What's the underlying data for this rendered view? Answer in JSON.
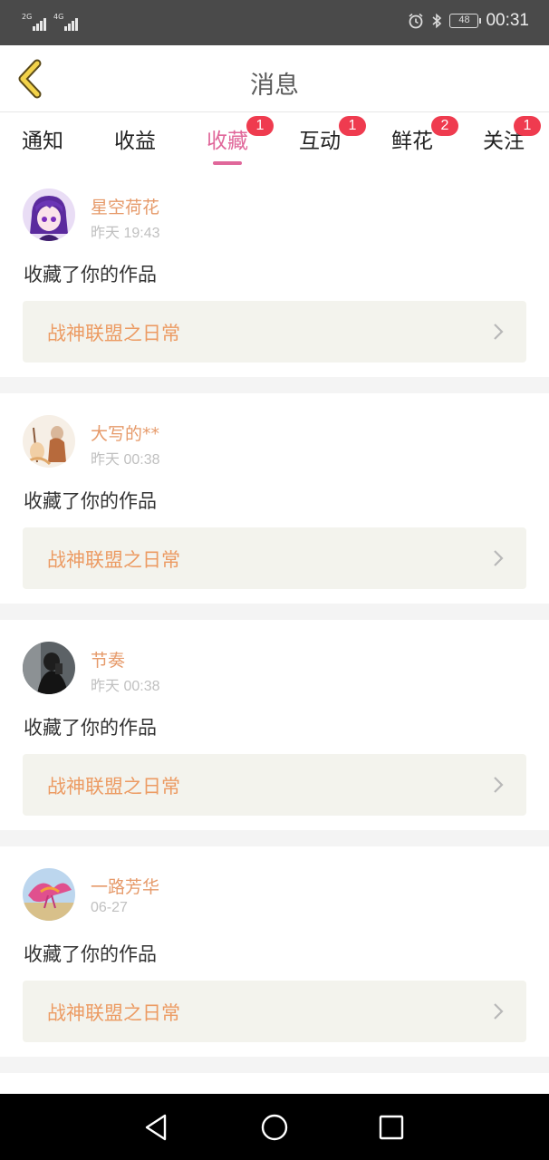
{
  "status_bar": {
    "signal1_label": "2G",
    "signal2_label": "4G",
    "battery": "48",
    "time": "00:31"
  },
  "header": {
    "title": "消息"
  },
  "tabs": [
    {
      "label": "通知",
      "badge": ""
    },
    {
      "label": "收益",
      "badge": ""
    },
    {
      "label": "收藏",
      "badge": "1"
    },
    {
      "label": "互动",
      "badge": "1"
    },
    {
      "label": "鲜花",
      "badge": "2"
    },
    {
      "label": "关注",
      "badge": "1"
    }
  ],
  "active_tab": "收藏",
  "colors": {
    "accent": "#e0679a",
    "badge": "#ef3b4f",
    "username": "#e69a6a",
    "work_title": "#ec9b63"
  },
  "feed": [
    {
      "username": "星空荷花",
      "time": "昨天 19:43",
      "action": "收藏了你的作品",
      "work_title": "战神联盟之日常",
      "avatar": "purple-anime-avatar"
    },
    {
      "username": "大写的**",
      "time": "昨天 00:38",
      "action": "收藏了你的作品",
      "work_title": "战神联盟之日常",
      "avatar": "illustration-figure-avatar"
    },
    {
      "username": "节奏",
      "time": "昨天 00:38",
      "action": "收藏了你的作品",
      "work_title": "战神联盟之日常",
      "avatar": "mirror-selfie-avatar"
    },
    {
      "username": "一路芳华",
      "time": "06-27",
      "action": "收藏了你的作品",
      "work_title": "战神联盟之日常",
      "avatar": "phoenix-avatar"
    }
  ]
}
